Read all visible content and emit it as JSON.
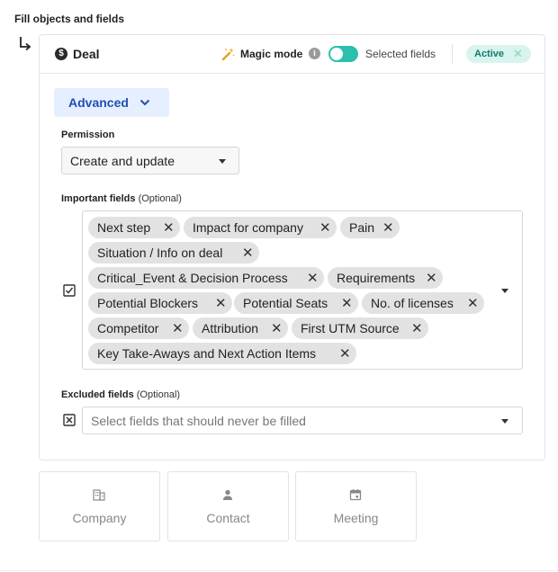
{
  "section_title": "Fill objects and fields",
  "deal": {
    "title": "Deal",
    "magic_mode_label": "Magic mode",
    "selected_fields_label": "Selected fields",
    "status_badge": "Active",
    "advanced_label": "Advanced"
  },
  "permission": {
    "label": "Permission",
    "value": "Create and update"
  },
  "important_fields": {
    "label": "Important fields",
    "optional": "(Optional)",
    "chips": [
      "Next step",
      "Impact for company",
      "Pain",
      "Situation / Info on deal",
      "Critical_Event & Decision Process",
      "Requirements",
      "Potential Blockers",
      "Potential Seats",
      "No. of licenses",
      "Competitor",
      "Attribution",
      "First UTM Source",
      "Key Take-Aways and Next Action Items"
    ]
  },
  "excluded_fields": {
    "label": "Excluded fields",
    "optional": "(Optional)",
    "placeholder": "Select fields that should never be filled"
  },
  "objects": [
    {
      "label": "Company",
      "icon": "building-icon"
    },
    {
      "label": "Contact",
      "icon": "person-icon"
    },
    {
      "label": "Meeting",
      "icon": "calendar-icon"
    }
  ],
  "colors": {
    "accent_blue": "#1f4fb4",
    "toggle_teal": "#2bbfae",
    "badge_bg": "#d8f4ee",
    "badge_text": "#137a6b",
    "chip_bg": "#e2e2e2"
  }
}
